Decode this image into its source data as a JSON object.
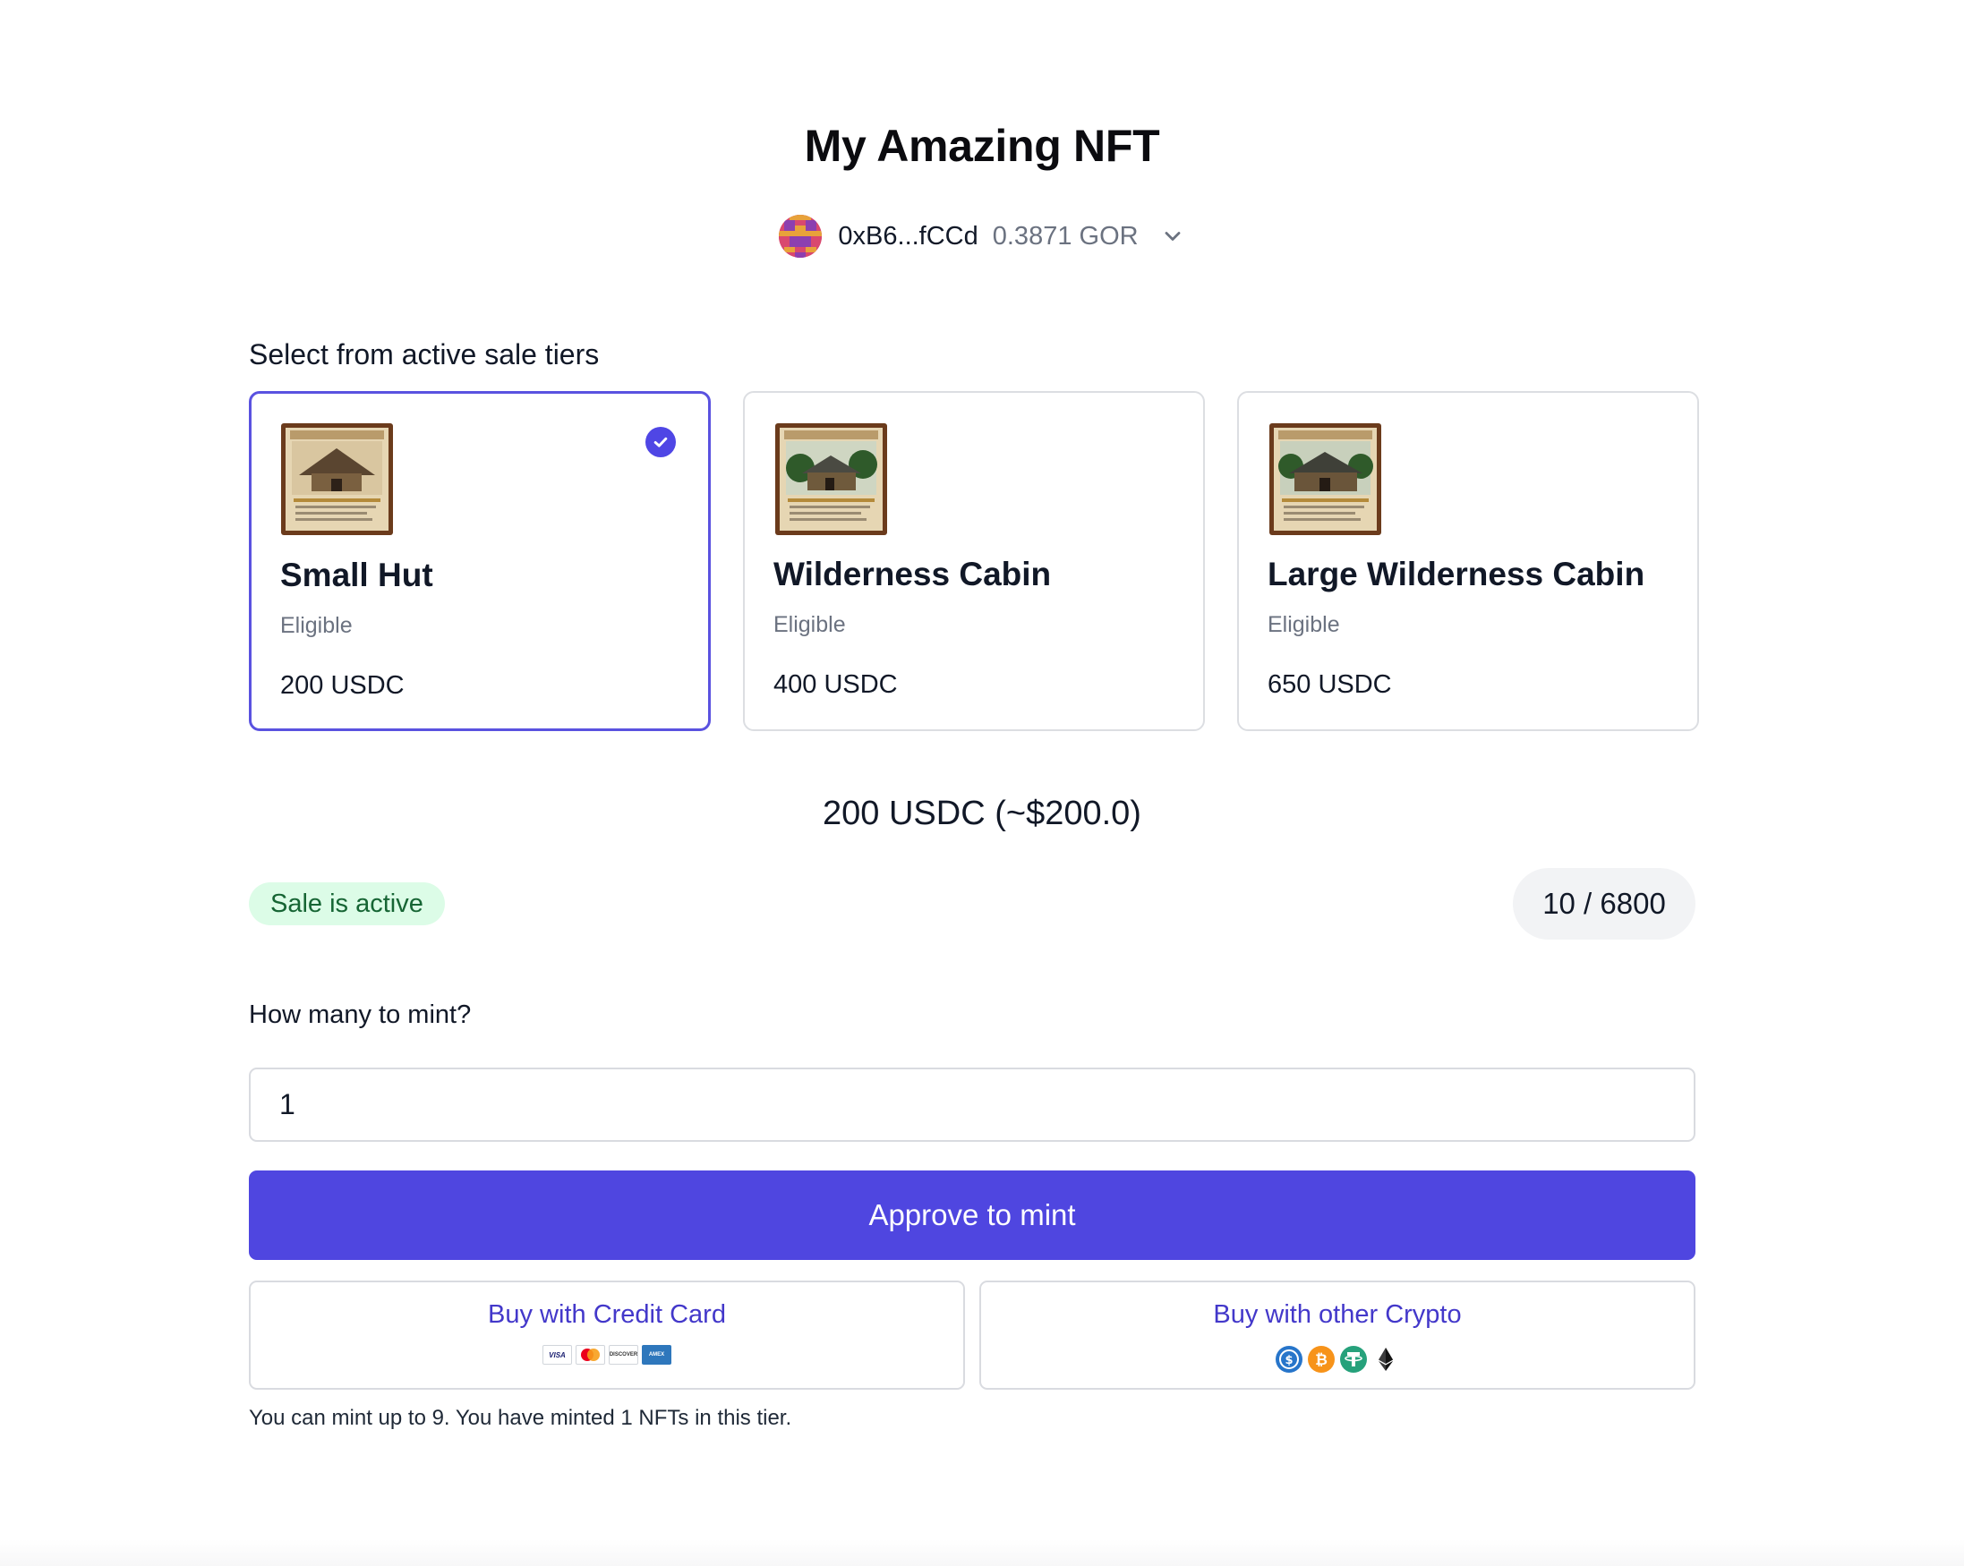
{
  "header": {
    "title": "My Amazing NFT"
  },
  "wallet": {
    "address": "0xB6...fCCd",
    "balance": "0.3871 GOR",
    "avatar_icon": "pixel-avatar-icon",
    "dropdown_icon": "chevron-down-icon"
  },
  "tiers_section": {
    "label": "Select from active sale tiers",
    "tiers": [
      {
        "name": "Small Hut",
        "status": "Eligible",
        "price": "200 USDC",
        "selected": true
      },
      {
        "name": "Wilderness Cabin",
        "status": "Eligible",
        "price": "400 USDC",
        "selected": false
      },
      {
        "name": "Large Wilderness Cabin",
        "status": "Eligible",
        "price": "650 USDC",
        "selected": false
      }
    ]
  },
  "summary": {
    "price_line": "200 USDC (~$200.0)",
    "sale_status": "Sale is active",
    "supply": "10 / 6800"
  },
  "mint": {
    "label": "How many to mint?",
    "quantity": "1",
    "approve_label": "Approve to mint",
    "credit_card_label": "Buy with Credit Card",
    "credit_card_logos": [
      "VISA",
      "Mastercard",
      "DISCOVER",
      "AMEX"
    ],
    "crypto_label": "Buy with other Crypto",
    "crypto_logos": [
      "usdc-icon",
      "bitcoin-icon",
      "tether-icon",
      "ethereum-icon"
    ],
    "note": "You can mint up to 9. You have minted 1 NFTs in this tier."
  },
  "colors": {
    "accent": "#4f46e0",
    "selected_border": "#5a52e0",
    "badge_green_bg": "#dcfce7",
    "badge_green_text": "#166534",
    "link": "#4338ca"
  }
}
